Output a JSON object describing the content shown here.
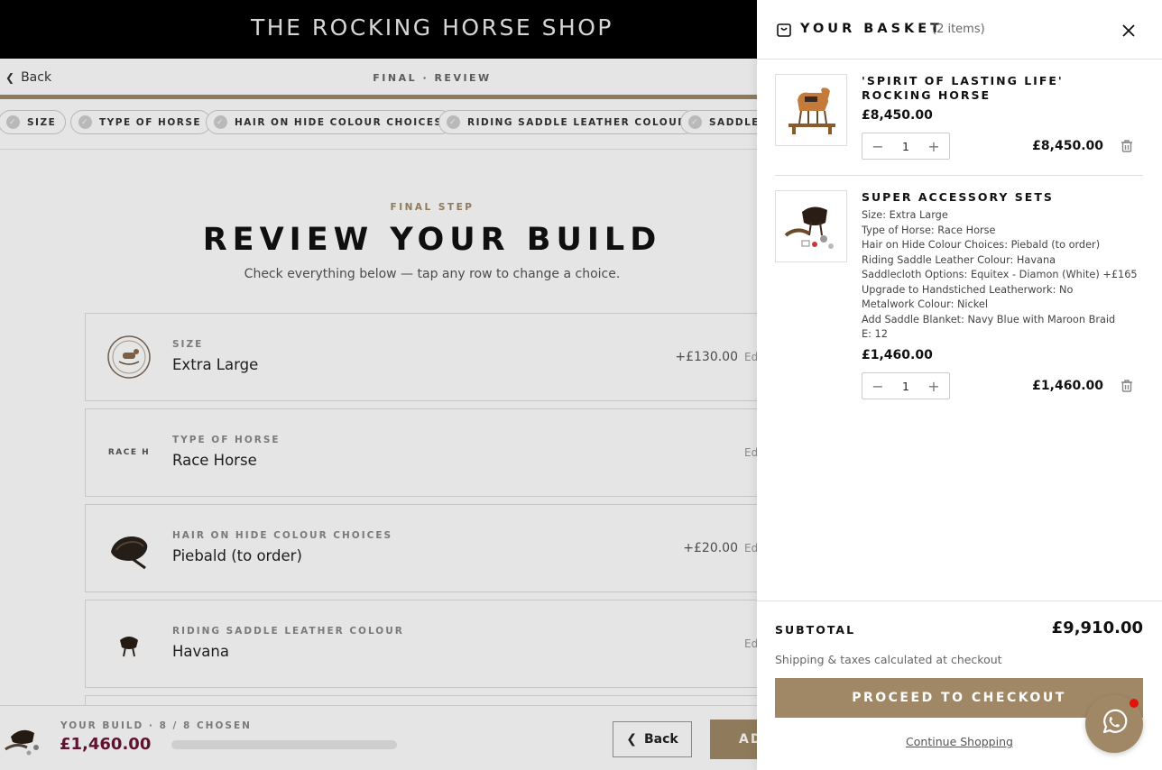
{
  "shop": {
    "brand": "THE ROCKING HORSE SHOP"
  },
  "subnav": {
    "back": "Back",
    "step": "FINAL · REVIEW"
  },
  "chips": [
    "SIZE",
    "TYPE OF HORSE",
    "HAIR ON HIDE COLOUR CHOICES",
    "RIDING SADDLE LEATHER COLOUR",
    "SADDLEC"
  ],
  "review": {
    "kicker": "FINAL STEP",
    "title": "REVIEW YOUR BUILD",
    "subtitle": "Check everything below — tap any row to change a choice.",
    "edit_label": "Ed",
    "rows": [
      {
        "label": "SIZE",
        "value": "Extra Large",
        "price": "+£130.00"
      },
      {
        "label": "TYPE OF HORSE",
        "value": "Race Horse",
        "price": "",
        "thumb_text": "RACE H"
      },
      {
        "label": "HAIR ON HIDE COLOUR CHOICES",
        "value": "Piebald (to order)",
        "price": "+£20.00"
      },
      {
        "label": "RIDING SADDLE LEATHER COLOUR",
        "value": "Havana",
        "price": ""
      }
    ]
  },
  "build_bar": {
    "label": "YOUR BUILD · 8 / 8 CHOSEN",
    "price": "£1,460.00",
    "back": "Back",
    "add": "AD"
  },
  "basket": {
    "title": "YOUR BASKET",
    "count": "(2 items)",
    "items": [
      {
        "title": "'SPIRIT OF LASTING LIFE' ROCKING HORSE",
        "price": "£8,450.00",
        "qty": "1",
        "line_total": "£8,450.00"
      },
      {
        "title": "SUPER ACCESSORY SETS",
        "options": [
          "Size: Extra Large",
          "Type of Horse: Race Horse",
          "Hair on Hide Colour Choices: Piebald (to order)",
          "Riding Saddle Leather Colour: Havana",
          "Saddlecloth Options: Equitex - Diamon (White) +£165",
          "Upgrade to Handstiched Leatherwork: No",
          "Metalwork Colour: Nickel",
          "Add Saddle Blanket: Navy Blue with Maroon Braid",
          "E: 12"
        ],
        "price": "£1,460.00",
        "qty": "1",
        "line_total": "£1,460.00"
      }
    ],
    "subtotal_label": "SUBTOTAL",
    "subtotal": "£9,910.00",
    "shipping_note": "Shipping & taxes calculated at checkout",
    "checkout": "PROCEED TO CHECKOUT",
    "continue": "Continue Shopping"
  },
  "colors": {
    "accent": "#a08866",
    "price_maroon": "#6b1636",
    "whatsapp_badge": "#e3120b"
  },
  "icons": [
    "bag-icon",
    "close-icon",
    "minus-icon",
    "plus-icon",
    "trash-icon",
    "whatsapp-icon",
    "chevron-left-icon",
    "check-icon"
  ]
}
